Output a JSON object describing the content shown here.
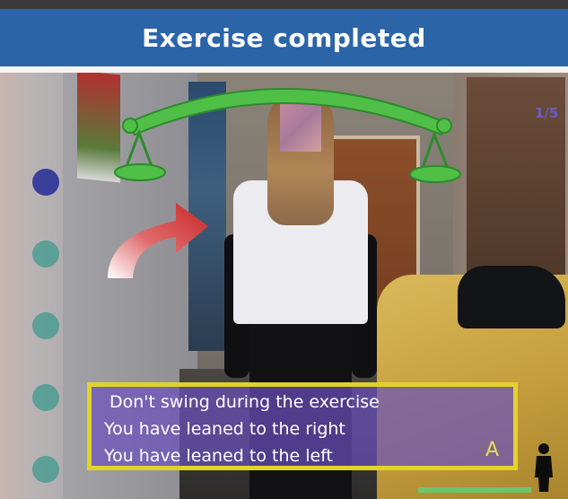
{
  "header": {
    "title": "Exercise completed"
  },
  "progress": {
    "label": "1/5",
    "current": 1,
    "total": 5
  },
  "feedback": {
    "lines": [
      "Don't swing during the exercise",
      "You have leaned to the right",
      "You have leaned to the left"
    ],
    "letter": "A"
  },
  "colors": {
    "title_bar": "#2c64a8",
    "balance": "#4fbf48",
    "arrow": "#d93a3a",
    "dot_active": "#3a3f9a",
    "dot_inactive": "#3f9a8e",
    "feedback_border": "#e3d22a",
    "feedback_fill": "#6950be",
    "status": "#6fc46a"
  },
  "icons": {
    "balance": "balance-scale-icon",
    "lean_direction": "curved-arrow-right-icon",
    "user": "person-silhouette-icon"
  }
}
